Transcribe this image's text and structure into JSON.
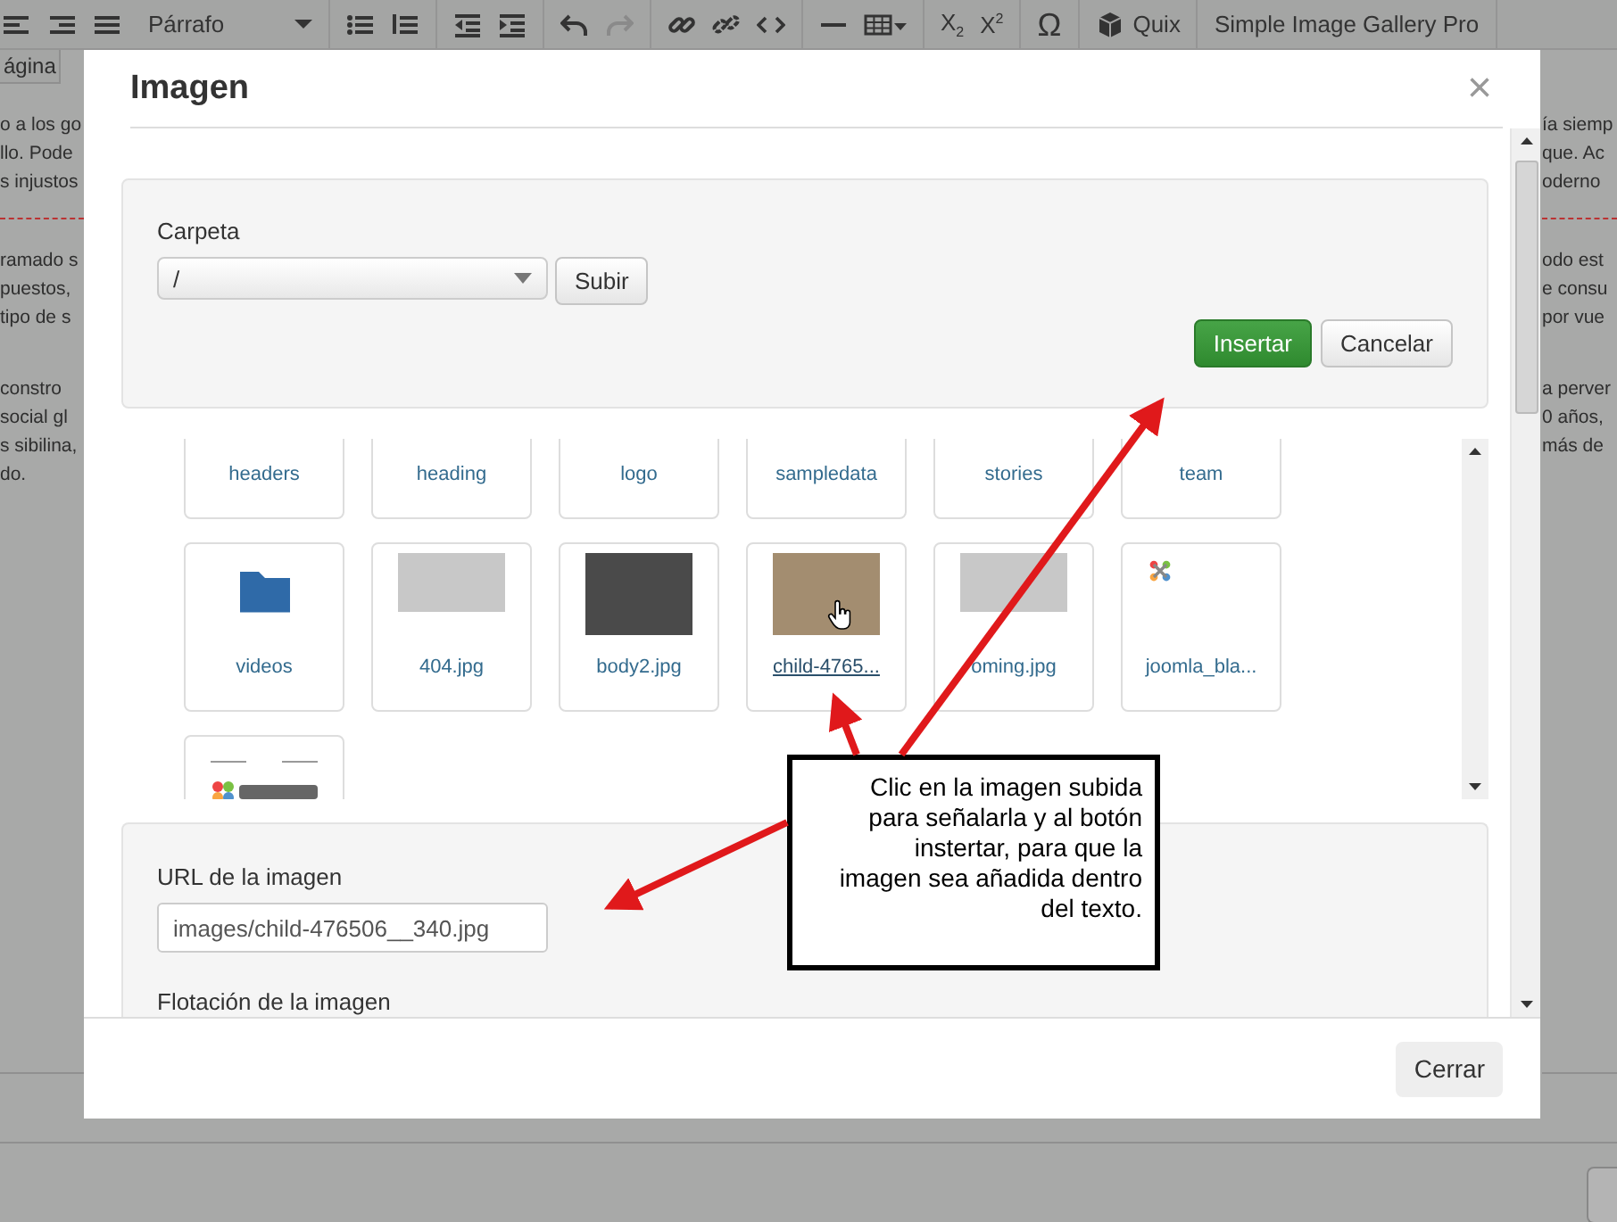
{
  "toolbar": {
    "format_select": "Párrafo",
    "redo_disabled": true,
    "subscript": "X$_{2}$",
    "superscript": "X$^{2}$",
    "special_char": "Ω",
    "quix": "Quix",
    "gallery": "Simple Image Gallery Pro"
  },
  "page_tab": "ágina",
  "background_text": {
    "left": [
      [
        "o a los go",
        "llo. Pode",
        "s injustos"
      ],
      [
        "ramado s",
        "puestos,",
        "tipo de s"
      ],
      [
        "constro",
        "social gl",
        "s sibilina,",
        "do."
      ]
    ],
    "right": [
      [
        "ía siemp",
        "que. Ac",
        "oderno"
      ],
      [
        "odo est",
        "e consu",
        "por vue"
      ],
      [
        "a perver",
        "0 años,",
        "más de"
      ]
    ]
  },
  "dialog": {
    "title": "Imagen",
    "close": "×",
    "folder_label": "Carpeta",
    "folder_value": "/",
    "upload_button": "Subir",
    "insert_button": "Insertar",
    "cancel_button": "Cancelar",
    "files": [
      {
        "name": "headers",
        "kind": "folder",
        "hovered": false
      },
      {
        "name": "heading",
        "kind": "folder",
        "hovered": false
      },
      {
        "name": "logo",
        "kind": "folder",
        "hovered": false
      },
      {
        "name": "sampledata",
        "kind": "folder",
        "hovered": false
      },
      {
        "name": "stories",
        "kind": "folder",
        "hovered": false
      },
      {
        "name": "team",
        "kind": "folder",
        "hovered": false
      },
      {
        "name": "videos",
        "kind": "folder",
        "hovered": false
      },
      {
        "name": "404.jpg",
        "kind": "sample",
        "hovered": false
      },
      {
        "name": "body2.jpg",
        "kind": "dark",
        "hovered": false
      },
      {
        "name": "child-4765...",
        "kind": "photo",
        "hovered": true
      },
      {
        "name": "oming.jpg",
        "kind": "sample",
        "hovered": false
      },
      {
        "name": "joomla_bla...",
        "kind": "icon",
        "hovered": false
      },
      {
        "kind": "logo",
        "hovered": false
      }
    ],
    "url_label": "URL de la imagen",
    "url_value": "images/child-476506__340.jpg",
    "float_label": "Flotación de la imagen",
    "close_button": "Cerrar"
  },
  "callout": {
    "text": "Clic en la imagen subida para señalarla y al botón instertar, para que la imagen sea añadida dentro del texto."
  }
}
